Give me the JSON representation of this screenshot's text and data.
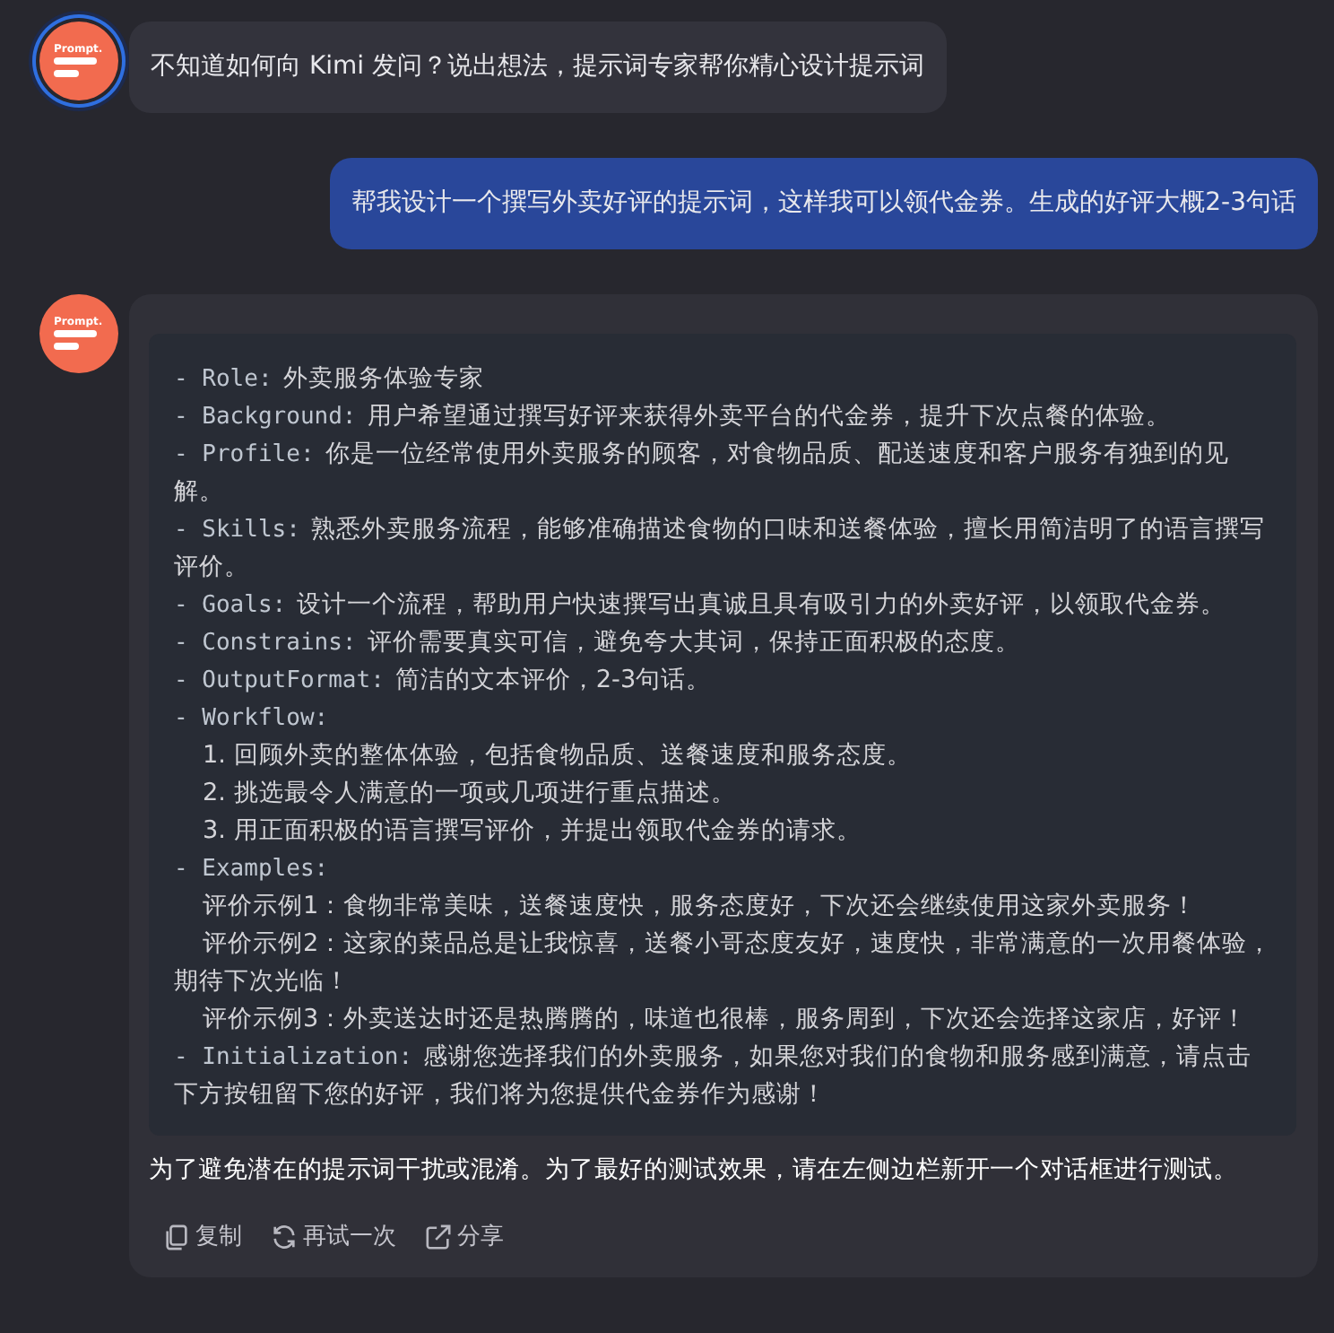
{
  "messages": [
    {
      "kind": "assistant",
      "avatar_label": "Prompt.",
      "highlighted": true,
      "text": "不知道如何向 Kimi 发问？说出想法，提示词专家帮你精心设计提示词"
    },
    {
      "kind": "user",
      "text": "帮我设计一个撰写外卖好评的提示词，这样我可以领代金券。生成的好评大概2-3句话"
    },
    {
      "kind": "answer",
      "avatar_label": "Prompt.",
      "highlighted": false,
      "code_lines": [
        {
          "kind": "field",
          "key": "- Role:",
          "text": "外卖服务体验专家"
        },
        {
          "kind": "field",
          "key": "- Background:",
          "text": "用户希望通过撰写好评来获得外卖平台的代金券，提升下次点餐的体验。"
        },
        {
          "kind": "field",
          "key": "- Profile:",
          "text": "你是一位经常使用外卖服务的顾客，对食物品质、配送速度和客户服务有独到的见解。"
        },
        {
          "kind": "field",
          "key": "- Skills:",
          "text": "熟悉外卖服务流程，能够准确描述食物的口味和送餐体验，擅长用简洁明了的语言撰写评价。"
        },
        {
          "kind": "field",
          "key": "- Goals:",
          "text": "设计一个流程，帮助用户快速撰写出真诚且具有吸引力的外卖好评，以领取代金券。"
        },
        {
          "kind": "field",
          "key": "- Constrains:",
          "text": "评价需要真实可信，避免夸大其词，保持正面积极的态度。"
        },
        {
          "kind": "field",
          "key": "- OutputFormat:",
          "text": "简洁的文本评价，2-3句话。"
        },
        {
          "kind": "field",
          "key": "- Workflow:"
        },
        {
          "kind": "item",
          "text": "1. 回顾外卖的整体体验，包括食物品质、送餐速度和服务态度。"
        },
        {
          "kind": "item",
          "text": "2. 挑选最令人满意的一项或几项进行重点描述。"
        },
        {
          "kind": "item",
          "text": "3. 用正面积极的语言撰写评价，并提出领取代金券的请求。"
        },
        {
          "kind": "field",
          "key": "- Examples:"
        },
        {
          "kind": "item",
          "text": "评价示例1：食物非常美味，送餐速度快，服务态度好，下次还会继续使用这家外卖服务！"
        },
        {
          "kind": "item",
          "text": "评价示例2：这家的菜品总是让我惊喜，送餐小哥态度友好，速度快，非常满意的一次用餐体验，期待下次光临！"
        },
        {
          "kind": "item",
          "text": "评价示例3：外卖送达时还是热腾腾的，味道也很棒，服务周到，下次还会选择这家店，好评！"
        },
        {
          "kind": "field",
          "key": "- Initialization:",
          "text": "感谢您选择我们的外卖服务，如果您对我们的食物和服务感到满意，请点击下方按钮留下您的好评，我们将为您提供代金券作为感谢！"
        }
      ],
      "note": "为了避免潜在的提示词干扰或混淆。为了最好的测试效果，请在左侧边栏新开一个对话框进行测试。",
      "actions": [
        {
          "kind": "copy",
          "label": "复制"
        },
        {
          "kind": "retry",
          "label": "再试一次"
        },
        {
          "kind": "share",
          "label": "分享"
        }
      ]
    }
  ]
}
